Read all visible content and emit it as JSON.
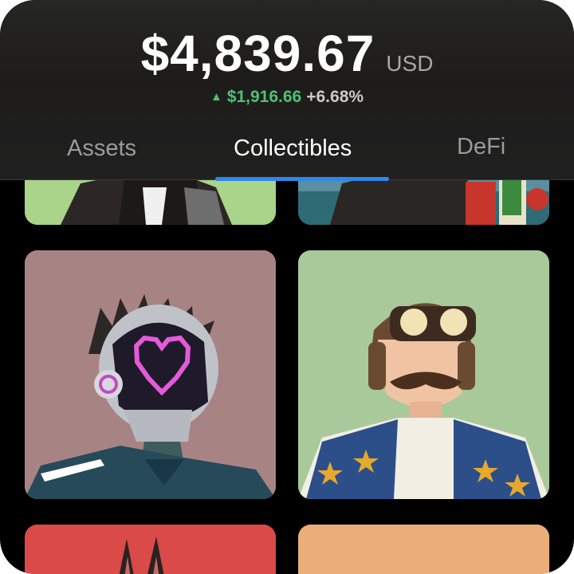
{
  "portfolio": {
    "balance": "$4,839.67",
    "currency": "USD",
    "change_amount": "$1,916.66",
    "change_percent": "+6.68%",
    "change_direction_icon": "triangle-up-icon",
    "positive_color": "#4fc173"
  },
  "tabs": [
    {
      "label": "Assets",
      "active": false
    },
    {
      "label": "Collectibles",
      "active": true
    },
    {
      "label": "DeFi",
      "active": false
    }
  ],
  "accent_color": "#2f87e8",
  "collectibles": [
    {
      "description": "partially visible NFT art: character on green background"
    },
    {
      "description": "partially visible NFT art: character with playing cards on teal background"
    },
    {
      "description": "NFT art: helmeted figure with pink pixel heart visor on mauve background"
    },
    {
      "description": "NFT art: mustached aviator with goggles and star jacket on green background"
    },
    {
      "description": "partially visible NFT art: rabbit ears on red background"
    },
    {
      "description": "partially visible NFT art: orange background"
    }
  ]
}
